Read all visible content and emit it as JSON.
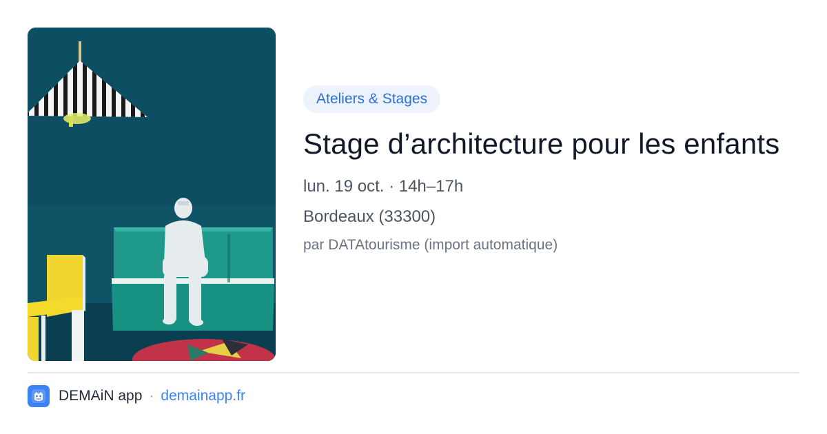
{
  "event": {
    "category": "Ateliers & Stages",
    "title": "Stage d’architecture pour les enfants",
    "datetime": "lun. 19 oct. · 14h–17h",
    "location": "Bordeaux (33300)",
    "source": "par DATAtourisme (import automatique)",
    "image": {
      "subject": "maquette d'architecture: personnage blanc assis sur un banc vert, chaise jaune, abat-jour rayé"
    }
  },
  "footer": {
    "app_name": "DEMAiN app",
    "separator": "·",
    "url": "demainapp.fr"
  },
  "colors": {
    "accent": "#3b82f6",
    "badge_bg": "#edf3fc",
    "badge_text": "#2f6fd6",
    "title": "#111827",
    "meta": "#4b5563",
    "muted": "#6b7280",
    "photo_wall": "#0d4f63"
  },
  "icons": {
    "app_logo": "demain-logo-icon"
  }
}
